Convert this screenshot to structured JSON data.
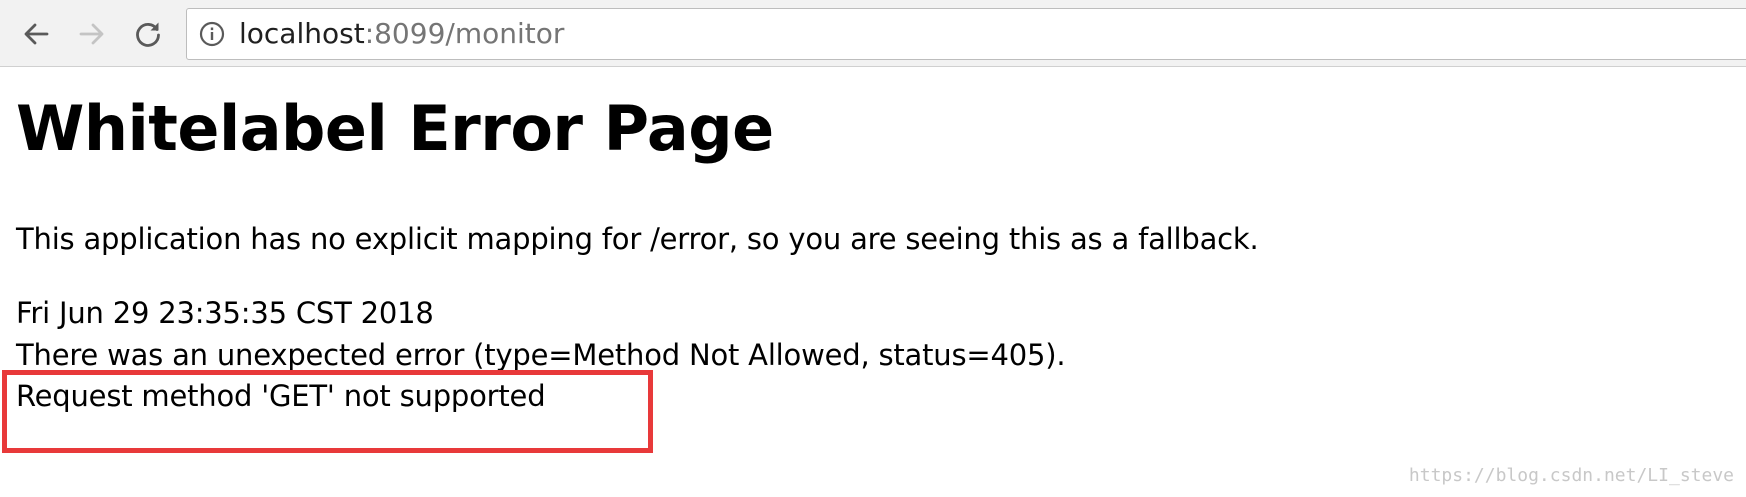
{
  "browser": {
    "url_host": "localhost",
    "url_rest": ":8099/monitor",
    "nav": {
      "back_icon": "arrow-left-icon",
      "forward_icon": "arrow-right-icon",
      "reload_icon": "reload-icon",
      "site_info_icon": "info-circle-icon"
    }
  },
  "page": {
    "title": "Whitelabel Error Page",
    "fallback_text": "This application has no explicit mapping for /error, so you are seeing this as a fallback.",
    "timestamp": "Fri Jun 29 23:35:35 CST 2018",
    "error_text": "There was an unexpected error (type=Method Not Allowed, status=405).",
    "message": "Request method 'GET' not supported"
  },
  "annotation": {
    "highlight_color": "#e8393a"
  },
  "watermark": "https://blog.csdn.net/LI_steve"
}
